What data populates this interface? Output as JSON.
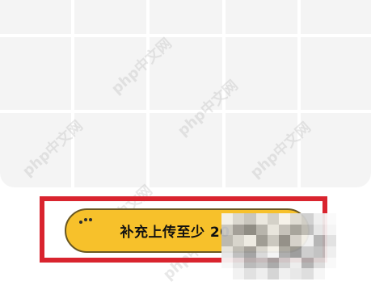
{
  "upload_button": {
    "label": "补充上传至少 20"
  },
  "watermark": {
    "text": "php中文网"
  },
  "colors": {
    "button_fill": "#f7c12b",
    "button_border": "#6a5822",
    "highlight_border": "#d9242e",
    "panel_background": "#f4f4f4"
  },
  "icons": {
    "button_decoration": "dots-icon",
    "mosaic": "mosaic-blur"
  }
}
